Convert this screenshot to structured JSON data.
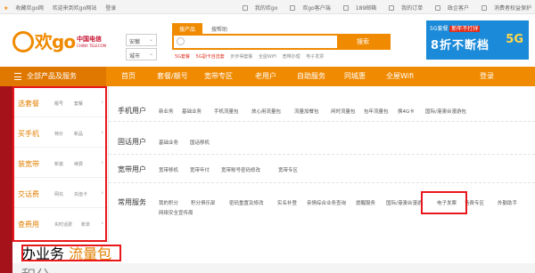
{
  "topbar": {
    "left": [
      "收藏欢go网",
      "欢迎来到欢go网站",
      "登录"
    ],
    "right": [
      "我的欢go",
      "欢go客户端",
      "189邮箱",
      "我的订单",
      "政企客户",
      "消费者权益保护"
    ]
  },
  "header": {
    "logo_text": "欢go",
    "carrier_name": "中国电信",
    "carrier_sub": "CHINA TELECOM",
    "province_select": "安徽",
    "city_select": "城市",
    "search_tabs": [
      "搜产品",
      "搜帮助"
    ],
    "search_placeholder": "",
    "search_button": "搜索",
    "hot_terms": [
      "5G套餐",
      "5G副卡自选套",
      "步步得套餐",
      "全屋WiFi",
      "宽带办理",
      "电子发票"
    ],
    "banner": {
      "line1": "5G套餐",
      "tag": "新年不打烊",
      "line2": "8折不断档",
      "badge": "5G"
    }
  },
  "nav": {
    "all_label": "全部产品及服务",
    "items": [
      "首页",
      "套餐/靓号",
      "宽带专区",
      "老用户",
      "自助服务",
      "同城惠",
      "全屋Wifi",
      "登录"
    ]
  },
  "sidebar": {
    "items": [
      {
        "title": "选套餐",
        "subs": [
          "靓号",
          "套餐"
        ]
      },
      {
        "title": "买手机",
        "subs": [
          "特价",
          "新品"
        ]
      },
      {
        "title": "装宽带",
        "subs": [
          "新装",
          "续费"
        ]
      },
      {
        "title": "交话费",
        "subs": [
          "网充",
          "充值卡"
        ]
      },
      {
        "title": "查费用",
        "subs": [
          "实时话费",
          "账单"
        ]
      }
    ],
    "bottom": {
      "title": "办业务",
      "subs": [
        "流量包",
        "积分"
      ]
    },
    "arrow": "›"
  },
  "panel": {
    "sections": [
      {
        "title": "手机用户",
        "links": [
          "新业务",
          "基础业务",
          "手机流量包",
          "放心用流量包",
          "流量加餐包",
          "闲时流量包",
          "包年流量包",
          "换4G卡",
          "国际/港澳台漫游包"
        ]
      },
      {
        "title": "固话用户",
        "links": [
          "基础业务",
          "国话移机"
        ]
      },
      {
        "title": "宽带用户",
        "links": [
          "宽带移机",
          "宽带年付",
          "宽带账号密码修改",
          "宽带专区"
        ]
      },
      {
        "title": "常用服务",
        "links_row1": [
          "我的积分",
          "积分俱乐部",
          "密码重置及修改",
          "实名补登",
          "亲情综合业务查询",
          "提醒服务",
          "国际/港澳台漫游",
          "电子发票",
          "话费专区",
          "外勤助手"
        ],
        "links_row2": [
          "网络安全宣传周"
        ]
      }
    ]
  }
}
